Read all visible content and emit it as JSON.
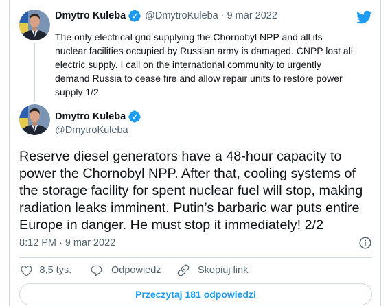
{
  "colors": {
    "text": "#0f1419",
    "secondary": "#536471",
    "accent": "#1d9bf0",
    "border": "#cfd9de",
    "background": "#ffffff"
  },
  "icons": {
    "logo": "twitter-bird-icon",
    "verified": "verified-badge-icon",
    "info": "info-icon",
    "like": "heart-icon",
    "reply": "reply-icon",
    "copy_link": "link-icon"
  },
  "parent_tweet": {
    "author_name": "Dmytro Kuleba",
    "author_handle": "@DmytroKuleba",
    "separator": "·",
    "date": "9 mar 2022",
    "verified": true,
    "text_lines": [
      "The only electrical grid supplying the Chornobyl NPP and all its",
      "nuclear facilities occupied by Russian army is damaged. CNPP lost all",
      "electric supply. I call on the international community to urgently",
      "demand Russia to cease fire and allow repair units to restore power",
      "supply 1/2"
    ]
  },
  "main_tweet": {
    "author_name": "Dmytro Kuleba",
    "author_handle": "@DmytroKuleba",
    "verified": true,
    "text_lines": [
      "Reserve diesel generators have a 48-hour capacity to",
      "power the Chornobyl NPP. After that, cooling systems of",
      "the storage facility for spent nuclear fuel will stop, making",
      "radiation leaks imminent. Putin’s barbaric war puts entire",
      "Europe in danger. He must stop it immediately! 2/2"
    ],
    "time": "8:12 PM",
    "separator": "·",
    "date": "9 mar 2022"
  },
  "actions": {
    "like_count": "8,5 tys.",
    "reply_label": "Odpowiedz",
    "copy_link_label": "Skopiuj link"
  },
  "read_replies_label": "Przeczytaj 181 odpowiedzi"
}
